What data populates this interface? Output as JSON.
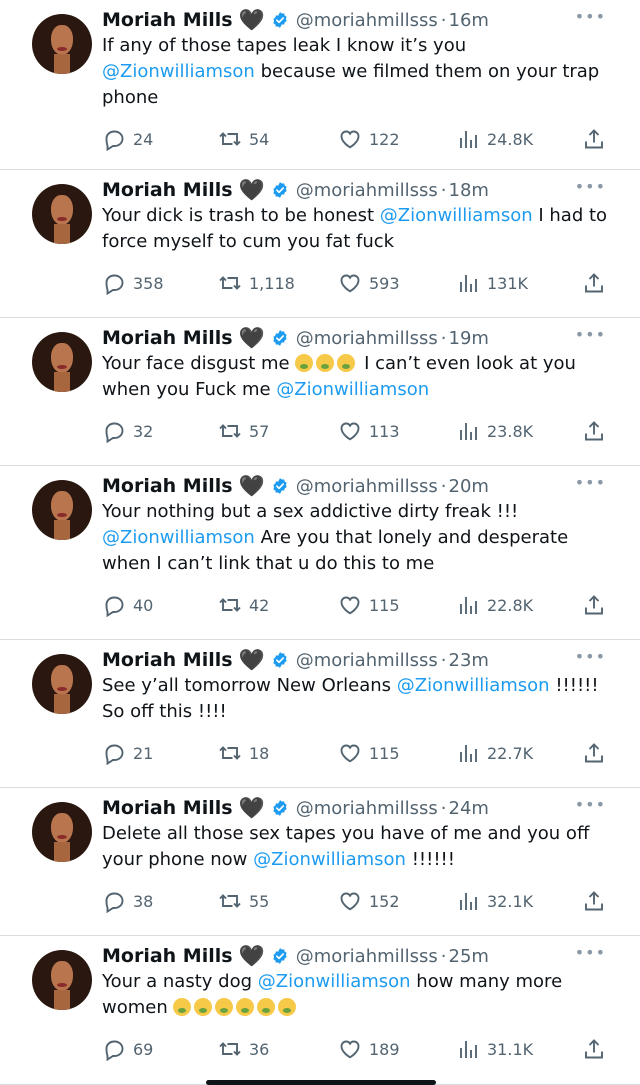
{
  "tweets": [
    {
      "name": "Moriah Mills",
      "heart": "🖤",
      "handle": "@moriahmillsss",
      "sep": "·",
      "time": "16m",
      "segments": [
        {
          "t": "If any of those tapes leak I know it’s you "
        },
        {
          "t": "@Zionwilliamson",
          "m": true
        },
        {
          "t": " because we filmed them on your trap phone"
        }
      ],
      "stats": {
        "replies": "24",
        "retweets": "54",
        "likes": "122",
        "views": "24.8K"
      }
    },
    {
      "name": "Moriah Mills",
      "heart": "🖤",
      "handle": "@moriahmillsss",
      "sep": "·",
      "time": "18m",
      "segments": [
        {
          "t": "Your dick is trash to be honest "
        },
        {
          "t": "@Zionwilliamson",
          "m": true
        },
        {
          "t": " I had to force myself to cum you fat fuck"
        }
      ],
      "stats": {
        "replies": "358",
        "retweets": "1,118",
        "likes": "593",
        "views": "131K"
      }
    },
    {
      "name": "Moriah Mills",
      "heart": "🖤",
      "handle": "@moriahmillsss",
      "sep": "·",
      "time": "19m",
      "segments": [
        {
          "t": "Your face disgust me "
        },
        {
          "e": 3
        },
        {
          "t": " I can’t even look at you when you Fuck me "
        },
        {
          "t": "@Zionwilliamson",
          "m": true
        }
      ],
      "stats": {
        "replies": "32",
        "retweets": "57",
        "likes": "113",
        "views": "23.8K"
      }
    },
    {
      "name": "Moriah Mills",
      "heart": "🖤",
      "handle": "@moriahmillsss",
      "sep": "·",
      "time": "20m",
      "segments": [
        {
          "t": "Your nothing but a sex addictive dirty freak !!! "
        },
        {
          "t": "@Zionwilliamson",
          "m": true
        },
        {
          "t": " Are you that lonely and desperate when I can’t link that u do this to me"
        }
      ],
      "stats": {
        "replies": "40",
        "retweets": "42",
        "likes": "115",
        "views": "22.8K"
      }
    },
    {
      "name": "Moriah Mills",
      "heart": "🖤",
      "handle": "@moriahmillsss",
      "sep": "·",
      "time": "23m",
      "segments": [
        {
          "t": "See y’all tomorrow New Orleans "
        },
        {
          "t": "@Zionwilliamson",
          "m": true
        },
        {
          "t": " !!!!!! So off this !!!!"
        }
      ],
      "stats": {
        "replies": "21",
        "retweets": "18",
        "likes": "115",
        "views": "22.7K"
      }
    },
    {
      "name": "Moriah Mills",
      "heart": "🖤",
      "handle": "@moriahmillsss",
      "sep": "·",
      "time": "24m",
      "segments": [
        {
          "t": "Delete all those sex tapes you have of me and you off your phone now "
        },
        {
          "t": "@Zionwilliamson",
          "m": true
        },
        {
          "t": " !!!!!!"
        }
      ],
      "stats": {
        "replies": "38",
        "retweets": "55",
        "likes": "152",
        "views": "32.1K"
      }
    },
    {
      "name": "Moriah Mills",
      "heart": "🖤",
      "handle": "@moriahmillsss",
      "sep": "·",
      "time": "25m",
      "segments": [
        {
          "t": "Your a nasty dog "
        },
        {
          "t": "@Zionwilliamson",
          "m": true
        },
        {
          "t": " how many more women "
        },
        {
          "e": 6
        }
      ],
      "stats": {
        "replies": "69",
        "retweets": "36",
        "likes": "189",
        "views": "31.1K"
      }
    }
  ],
  "icons": {
    "reply": "reply-icon",
    "retweet": "retweet-icon",
    "like": "like-icon",
    "views": "views-icon",
    "share": "share-icon",
    "verified": "verified-badge-icon",
    "more": "more-icon",
    "emoji": "nauseated-face-emoji"
  },
  "colors": {
    "mention": "#1d9bf0",
    "verified": "#1d9bf0",
    "muted": "#536471",
    "divider": "#d9dde1"
  }
}
